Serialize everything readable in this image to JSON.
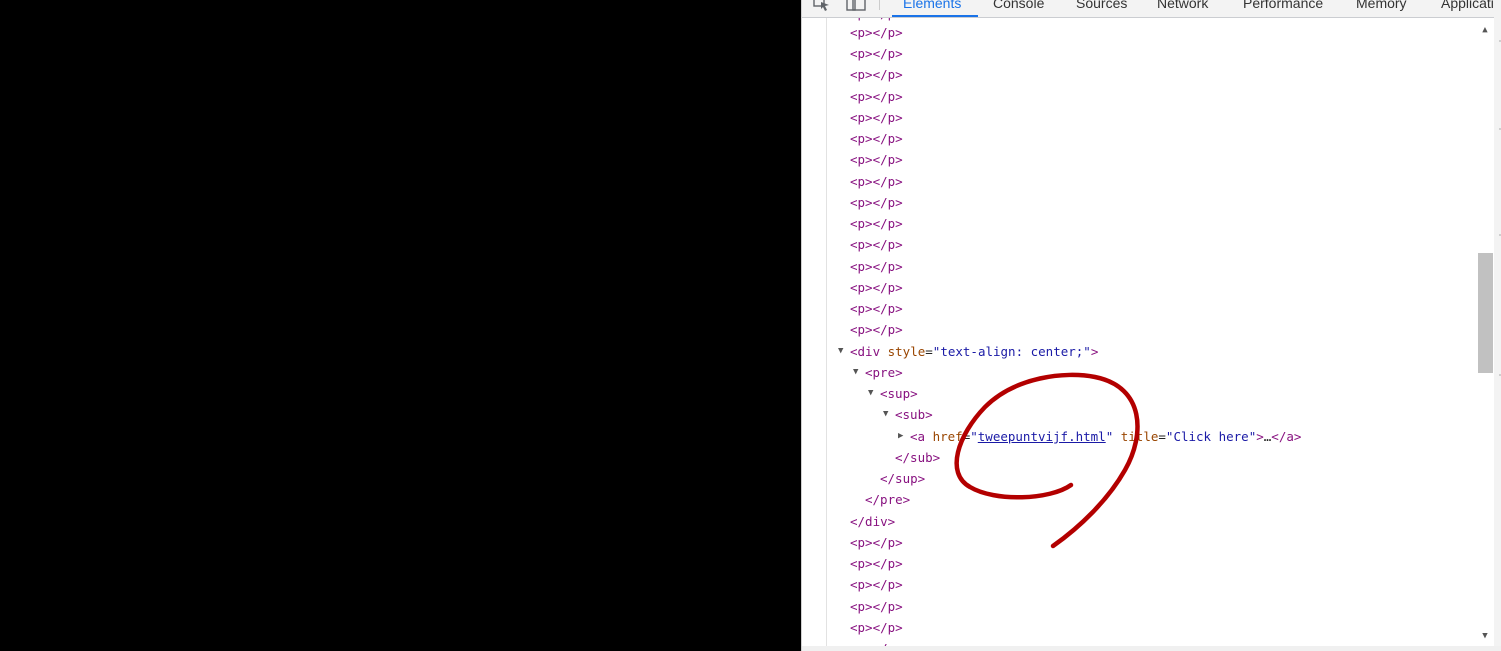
{
  "toolbar": {
    "tabs": [
      {
        "label": "Elements",
        "active": true
      },
      {
        "label": "Console"
      },
      {
        "label": "Sources"
      },
      {
        "label": "Network"
      },
      {
        "label": "Performance"
      },
      {
        "label": "Memory"
      },
      {
        "label": "Applicatio"
      }
    ]
  },
  "tree": {
    "p_open": "<p>",
    "p_close": "</p>",
    "div": {
      "open": "<div",
      "attr_name": " style",
      "eq": "=",
      "attr_value": "\"text-align: center;\"",
      "end": ">",
      "close": "</div>"
    },
    "pre": {
      "open": "<pre>",
      "close": "</pre>"
    },
    "sup": {
      "open": "<sup>",
      "close": "</sup>"
    },
    "sub": {
      "open": "<sub>",
      "close": "</sub>"
    },
    "anchor": {
      "open": "<a",
      "href_name": " href",
      "eq": "=",
      "quote": "\"",
      "href_value": "tweepuntvijf.html",
      "title_name": " title",
      "title_value": "\"Click here\"",
      "end": ">",
      "ellipsis": "…",
      "close": "</a>"
    }
  },
  "colors": {
    "tag": "#881280",
    "attribute": "#994500",
    "value": "#1a1aa6",
    "annotation": "#b30000",
    "active_tab": "#1a73e8"
  },
  "icons": [
    "inspect-element-icon",
    "device-toolbar-icon",
    "expand-triangle-icon",
    "collapse-triangle-icon",
    "scroll-up-arrow-icon",
    "scroll-down-arrow-icon"
  ]
}
